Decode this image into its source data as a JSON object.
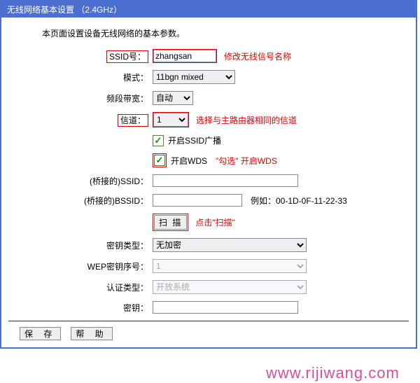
{
  "header": {
    "title": "无线网络基本设置 （2.4GHz）"
  },
  "intro": "本页面设置设备无线网络的基本参数。",
  "fields": {
    "ssid_label": "SSID号：",
    "ssid_value": "zhangsan",
    "ssid_note": "修改无线信号名称",
    "mode_label": "模式：",
    "mode_value": "11bgn mixed",
    "band_label": "频段带宽：",
    "band_value": "自动",
    "chan_label": "信道：",
    "chan_value": "1",
    "chan_note": "选择与主路由器相同的信道",
    "ssid_broadcast_label": "开启SSID广播",
    "wds_label": "开启WDS",
    "wds_note": "\"勾选\" 开启WDS",
    "bridge_ssid_label": "(桥接的)SSID：",
    "bridge_ssid_value": "",
    "bridge_bssid_label": "(桥接的)BSSID：",
    "bridge_bssid_value": "",
    "bssid_example": "例如：00-1D-0F-11-22-33",
    "scan_button": "扫 描",
    "scan_note": "点击\"扫描\"",
    "enc_label": "密钥类型：",
    "enc_value": "无加密",
    "wepidx_label": "WEP密钥序号：",
    "wepidx_value": "1",
    "auth_label": "认证类型：",
    "auth_value": "开放系统",
    "key_label": "密钥：",
    "key_value": ""
  },
  "buttons": {
    "save": "保 存",
    "help": "帮 助"
  },
  "watermark": "www.rijiwang.com"
}
